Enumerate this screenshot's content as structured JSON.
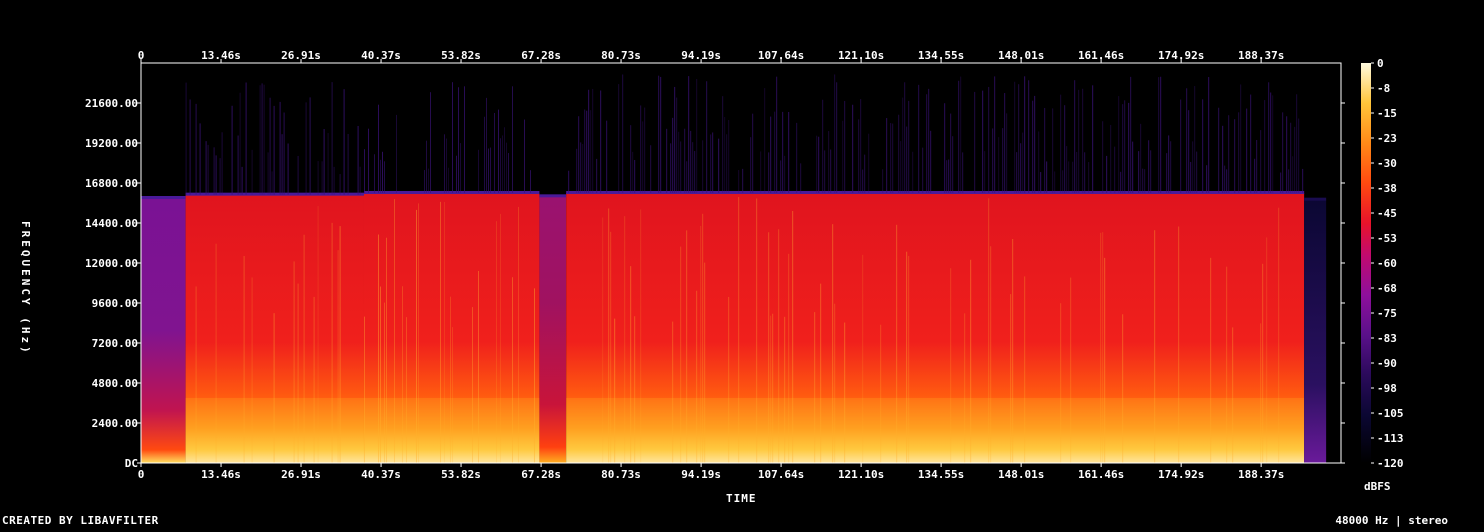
{
  "chart_data": {
    "type": "heatmap",
    "xlabel": "TIME",
    "ylabel": "FREQUENCY (Hz)",
    "x_ticks": [
      "0",
      "13.46s",
      "26.91s",
      "40.37s",
      "53.82s",
      "67.28s",
      "80.73s",
      "94.19s",
      "107.64s",
      "121.10s",
      "134.55s",
      "148.01s",
      "161.46s",
      "174.92s",
      "188.37s"
    ],
    "x_tick_values": [
      0,
      13.46,
      26.91,
      40.37,
      53.82,
      67.28,
      80.73,
      94.19,
      107.64,
      121.1,
      134.55,
      148.01,
      161.46,
      174.92,
      188.37
    ],
    "xlim": [
      0,
      201.8
    ],
    "y_ticks": [
      "DC",
      "2400.00",
      "4800.00",
      "7200.00",
      "9600.00",
      "12000.00",
      "14400.00",
      "16800.00",
      "19200.00",
      "21600.00"
    ],
    "y_tick_values": [
      0,
      2400,
      4800,
      7200,
      9600,
      12000,
      14400,
      16800,
      19200,
      21600
    ],
    "ylim": [
      0,
      24000
    ],
    "colorbar": {
      "unit": "dBFS",
      "ticks": [
        "0",
        "-8",
        "-15",
        "-23",
        "-30",
        "-38",
        "-45",
        "-53",
        "-60",
        "-68",
        "-75",
        "-83",
        "-90",
        "-98",
        "-105",
        "-113",
        "-120"
      ],
      "range": [
        -120,
        0
      ]
    },
    "segments": [
      {
        "start": 0.0,
        "end": 7.5,
        "cutoff_hz": 15900,
        "level": "low"
      },
      {
        "start": 7.5,
        "end": 37.5,
        "cutoff_hz": 16100,
        "level": "high"
      },
      {
        "start": 37.5,
        "end": 67.0,
        "cutoff_hz": 16200,
        "level": "high"
      },
      {
        "start": 67.0,
        "end": 71.5,
        "cutoff_hz": 16000,
        "level": "mid"
      },
      {
        "start": 71.5,
        "end": 195.6,
        "cutoff_hz": 16200,
        "level": "high"
      },
      {
        "start": 195.6,
        "end": 199.3,
        "cutoff_hz": 15800,
        "level": "fade"
      }
    ]
  },
  "footer": {
    "left": "CREATED BY LIBAVFILTER",
    "right": "48000 Hz | stereo"
  },
  "colors": {
    "background": "#000000",
    "axis": "#ffffff",
    "palette": [
      "#000000",
      "#0b0733",
      "#2a0a5a",
      "#5a108a",
      "#8e0f9c",
      "#c20a6e",
      "#e8132a",
      "#ff3a10",
      "#ff7a10",
      "#ffb020",
      "#ffe060",
      "#fffbe0"
    ]
  }
}
